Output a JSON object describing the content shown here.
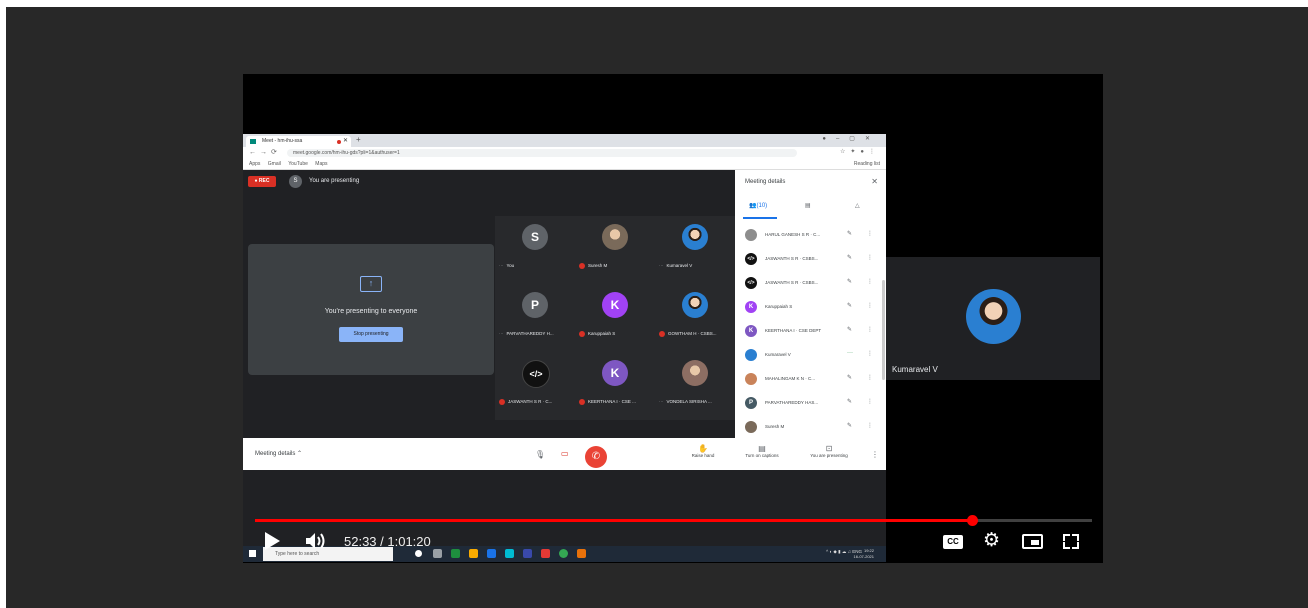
{
  "screen": {
    "browser": {
      "tab_title": "Meet - hm-ihu-ssa",
      "url": "meet.google.com/hm-ihu-gds?pli=1&authuser=1",
      "bookmarks": [
        "Apps",
        "Gmail",
        "YouTube",
        "Maps"
      ],
      "reading_list": "Reading list"
    },
    "meet": {
      "rec_label": "REC",
      "self_initial": "S",
      "presenting_label": "You are presenting",
      "present_card_text": "You're presenting to everyone",
      "stop_button": "Stop presenting",
      "tiles": [
        {
          "initial": "S",
          "name": "You",
          "color": "#5f6368"
        },
        {
          "initial": "",
          "name": "Suresh M",
          "color": "#7a6a5a"
        },
        {
          "initial": "",
          "name": "Kumaravel V",
          "color": "#2a7fd1"
        },
        {
          "initial": "P",
          "name": "PARVATHAREDDY H...",
          "color": "#5f6368"
        },
        {
          "initial": "K",
          "name": "Karuppaiah S",
          "color": "#a142f4"
        },
        {
          "initial": "",
          "name": "GOWTHAM H · CSBS...",
          "color": "#2a7fd1"
        },
        {
          "initial": "</>",
          "name": "JASWANTH S R · C...",
          "color": "#111111"
        },
        {
          "initial": "K",
          "name": "KEERTHANA I · CSE ...",
          "color": "#7e57c2"
        },
        {
          "initial": "",
          "name": "VONDELA SIRISHA ...",
          "color": "#8d6e63"
        }
      ]
    },
    "panel": {
      "title": "Meeting details",
      "close": "✕",
      "tab_people": "(10)",
      "participants": [
        {
          "initial": "",
          "name": "HARUL GANESH S R · C...",
          "color": "#8d8d8d"
        },
        {
          "initial": "</>",
          "name": "JASWANTH S R · CSBS...",
          "color": "#111111"
        },
        {
          "initial": "</>",
          "name": "JASWANTH S R · CSBS...",
          "color": "#111111"
        },
        {
          "initial": "K",
          "name": "Karuppaiah S",
          "color": "#a142f4"
        },
        {
          "initial": "K",
          "name": "KEERTHANA I · CSE DEPT",
          "color": "#7e57c2"
        },
        {
          "initial": "",
          "name": "Kumaravel V",
          "color": "#2a7fd1"
        },
        {
          "initial": "",
          "name": "MAHALINGAM K N · C...",
          "color": "#c9835a"
        },
        {
          "initial": "P",
          "name": "PARVATHAREDDY HAS...",
          "color": "#455a64"
        },
        {
          "initial": "",
          "name": "Suresh M",
          "color": "#7a6a5a"
        }
      ]
    },
    "controls": {
      "meeting_details": "Meeting details",
      "raise_hand": "Raise hand",
      "captions": "Turn on captions",
      "presenting": "You are presenting"
    },
    "taskbar": {
      "search_placeholder": "Type here to search",
      "time": "19:22",
      "date": "16-07-2021",
      "lang": "ENG"
    }
  },
  "speaker": {
    "name": "Kumaravel V"
  },
  "player": {
    "time_display": "52:33 / 1:01:20",
    "progress": 0.857,
    "cc_label": "CC"
  },
  "colors": {
    "progress": "#ff0000",
    "meet_bg": "#202124",
    "stage_bg": "#282828"
  }
}
